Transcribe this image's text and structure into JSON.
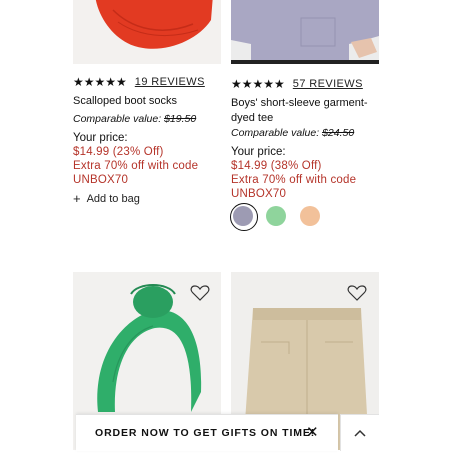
{
  "products": [
    {
      "stars": "★★★★★",
      "reviews": "19 REVIEWS",
      "name": "Scalloped boot socks",
      "comparable_label": "Comparable value:",
      "comparable_value": "$19.50",
      "price_label": "Your price:",
      "price": "$14.99 (23% Off)",
      "promo_line1": "Extra 70% off with code",
      "promo_line2": "UNBOX70",
      "add_to_bag": "Add to bag",
      "image_icon": "red-socks-image"
    },
    {
      "stars": "★★★★★",
      "reviews": "57 REVIEWS",
      "name_line1": "Boys' short-sleeve garment-",
      "name_line2": "dyed tee",
      "comparable_label": "Comparable value:",
      "comparable_value": "$24.50",
      "price_label": "Your price:",
      "price": "$14.99 (38% Off)",
      "promo_line1": "Extra 70% off with code",
      "promo_line2": "UNBOX70",
      "swatches": [
        "#9d9bb3",
        "#8fd49c",
        "#f2c19a"
      ],
      "image_icon": "lavender-tee-image"
    },
    {
      "image_icon": "green-knotted-headband-image"
    },
    {
      "image_icon": "khaki-shorts-image"
    }
  ],
  "banner": {
    "text": "ORDER NOW TO GET GIFTS ON TIME!",
    "close": "✕"
  },
  "colors": {
    "price_red": "#b5342a",
    "sock_red": "#e23a22",
    "headband_green": "#2fae6a",
    "shorts_khaki": "#d8c9ab"
  }
}
